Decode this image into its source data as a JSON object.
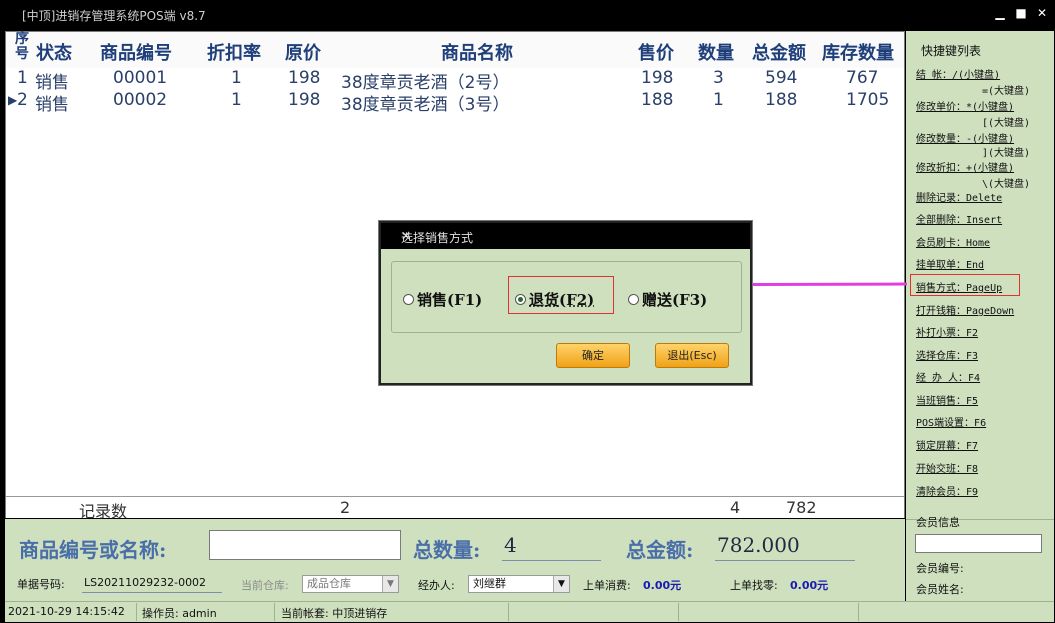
{
  "window": {
    "title": "[中顶]进销存管理系统POS端 v8.7",
    "min": "▁",
    "max": "■",
    "close": "✕"
  },
  "grid": {
    "headers": {
      "seq": "序号",
      "status": "状态",
      "code": "商品编号",
      "discount": "折扣率",
      "orig_price": "原价",
      "name": "商品名称",
      "price": "售价",
      "qty": "数量",
      "amount": "总金额",
      "stock": "库存数量"
    },
    "rows": [
      {
        "seq": "1",
        "status": "销售",
        "code": "00001",
        "discount": "1",
        "orig_price": "198",
        "name": "38度章贡老酒（2号）",
        "price": "198",
        "qty": "3",
        "amount": "594",
        "stock": "767"
      },
      {
        "seq": "2",
        "status": "销售",
        "code": "00002",
        "discount": "1",
        "orig_price": "198",
        "name": "38度章贡老酒（3号）",
        "price": "188",
        "qty": "1",
        "amount": "188",
        "stock": "1705"
      }
    ],
    "current_row_marker": "▶",
    "footer": {
      "label": "记录数",
      "count": "2",
      "qty": "4",
      "amount": "782"
    }
  },
  "shortcuts": {
    "title": "快捷键列表",
    "items": [
      "结    帐：/(小键盘)",
      "=(大键盘)",
      "修改单价：*(小键盘)",
      "[(大键盘)",
      "修改数量：-(小键盘)",
      "](大键盘)",
      "修改折扣：+(小键盘)",
      "\\(大键盘)",
      "删除记录：Delete",
      "全部删除：Insert",
      "会员刷卡：Home",
      "挂单取单：End",
      "销售方式：PageUp",
      "打开钱箱：PageDown",
      "补打小票：F2",
      "选择仓库：F3",
      "经 办 人：F4",
      "当班销售：F5",
      "POS端设置：F6",
      "锁定屏幕：F7",
      "开始交班：F8",
      "清除会员：F9"
    ]
  },
  "bottom": {
    "code_label": "商品编号或名称:",
    "code_value": "",
    "total_qty_label": "总数量:",
    "total_qty": "4",
    "total_amount_label": "总金额:",
    "total_amount": "782.000",
    "doc_no_label": "单据号码:",
    "doc_no": "LS20211029232-0002",
    "warehouse_label": "当前仓库:",
    "warehouse": "成品仓库",
    "handler_label": "经办人:",
    "handler": "刘继群",
    "last_consume_label": "上单消费:",
    "last_consume": "0.00元",
    "last_change_label": "上单找零:",
    "last_change": "0.00元"
  },
  "member": {
    "info_label": "会员信息",
    "no_label": "会员编号:",
    "name_label": "会员姓名:"
  },
  "status": {
    "datetime": "2021-10-29 14:15:42",
    "operator": "操作员: admin",
    "account": "当前帐套: 中顶进销存"
  },
  "dialog": {
    "title": "选择销售方式",
    "options": [
      "销售(F1)",
      "退货(F2)",
      "赠送(F3)"
    ],
    "selected": "退货(F2)",
    "ok": "确定",
    "cancel": "退出(Esc)"
  },
  "colors": {
    "panel": "#cfe0bf",
    "header_text": "#1f3f7a",
    "highlight": "#e03030",
    "arrow": "#e040e0",
    "button": "#f0a216"
  }
}
